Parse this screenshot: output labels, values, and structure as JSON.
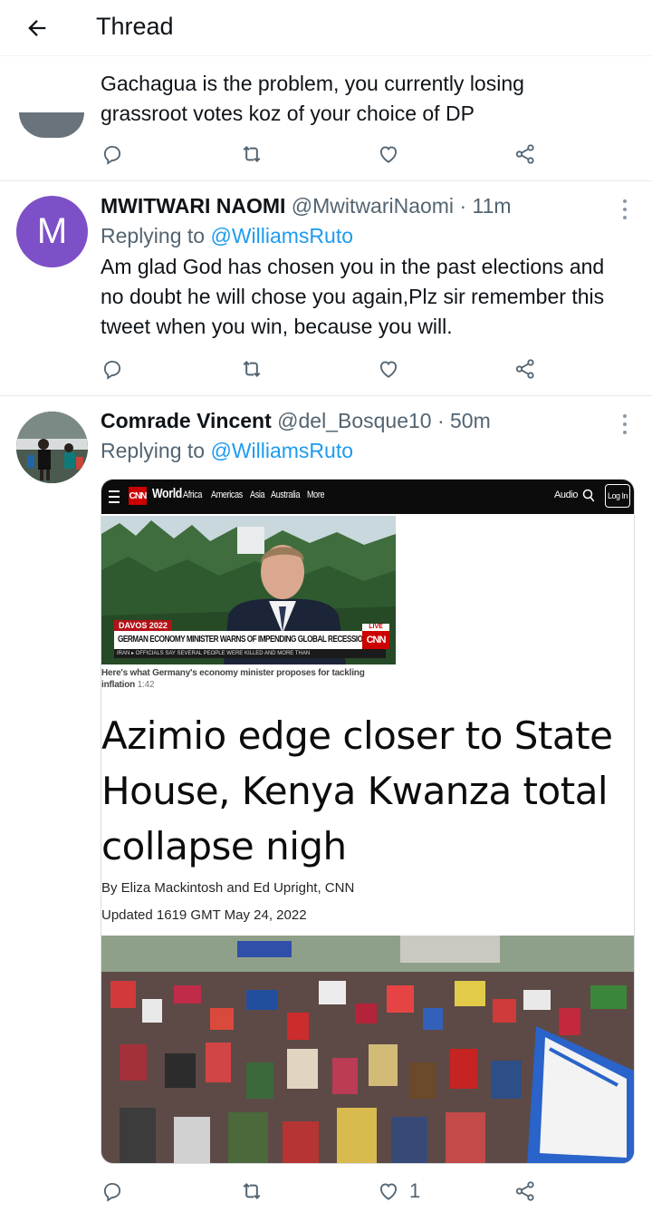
{
  "header": {
    "title": "Thread",
    "back_icon": "arrow-left-icon"
  },
  "tweets": [
    {
      "text": "Gachagua is the problem, you currently losing grassroot votes koz of your choice of DP",
      "actions": {
        "reply": "",
        "retweet": "",
        "like": "",
        "share": ""
      }
    },
    {
      "avatar_letter": "M",
      "avatar_color": "#7e50c7",
      "name": "MWITWARI NAOMI",
      "handle": "@MwitwariNaomi",
      "time": "· 11m",
      "replying_prefix": "Replying to",
      "replying_to": "@WilliamsRuto",
      "text": "Am glad God has chosen you in the past elections and no doubt  he will chose you again,Plz sir remember this tweet when you win, because you will.",
      "actions": {
        "reply": "",
        "retweet": "",
        "like": "",
        "share": ""
      }
    },
    {
      "name": "Comrade Vincent",
      "handle": "@del_Bosque10",
      "time": "· 50m",
      "replying_prefix": "Replying to",
      "replying_to": "@WilliamsRuto",
      "actions": {
        "reply": "",
        "retweet": "",
        "like": "1",
        "share": ""
      },
      "media": {
        "cnn_logo": "CNN",
        "cnn_nav": [
          "World",
          "Africa",
          "Americas",
          "Asia",
          "Australia",
          "More"
        ],
        "audio": "Audio",
        "login": "Log In",
        "video_tag": "DAVOS 2022",
        "video_headline": "GERMAN ECONOMY MINISTER WARNS OF IMPENDING GLOBAL RECESSION",
        "video_ticker": "IRAN  ▸ OFFICIALS SAY SEVERAL PEOPLE WERE KILLED AND MORE THAN",
        "live": "LIVE",
        "caption": "Here's what Germany's economy minister proposes for tackling inflation",
        "duration": "1:42",
        "headline": "Azimio edge closer to State House, Kenya Kwanza total collapse nigh",
        "byline": "By Eliza Mackintosh and Ed Upright, CNN",
        "updated": "Updated 1619 GMT May 24, 2022"
      }
    }
  ],
  "colors": {
    "link": "#1d9bf0",
    "muted": "#536471",
    "text": "#0f1419",
    "cnn_red": "#cc0000"
  }
}
